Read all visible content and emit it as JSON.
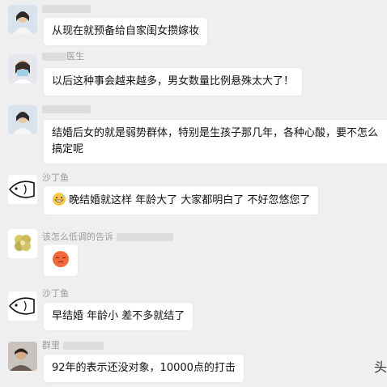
{
  "messages": [
    {
      "name": "",
      "text": "从现在就预备给自家闺女攒嫁妆"
    },
    {
      "name": "医生",
      "text": "以后这种事会越来越多，男女数量比例悬殊太大了！"
    },
    {
      "name": "",
      "text": "结婚后女的就是弱势群体，特别是生孩子那几年，各种心酸，要不怎么",
      "text2": "搞定呢"
    },
    {
      "name": "沙丁鱼",
      "emoji": "grinning-sweat-emoji",
      "text": "晚结婚就这样 年龄大了 大家都明白了 不好忽悠您了"
    },
    {
      "name": "该怎么低调的告诉",
      "emoji": "sad-face-emoji"
    },
    {
      "name": "沙丁鱼",
      "text": "早结婚 年龄小 差不多就结了"
    },
    {
      "name": "群里",
      "text": "92年的表示还没对象，10000点的打击"
    }
  ],
  "watermark": "头"
}
